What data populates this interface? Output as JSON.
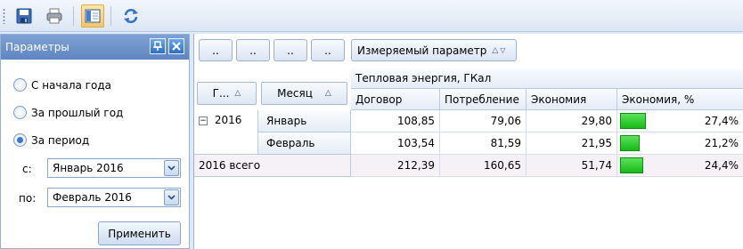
{
  "toolbar": {
    "icons": [
      "save-icon",
      "print-icon",
      "panel-toggle-icon",
      "refresh-icon"
    ]
  },
  "params": {
    "title": "Параметры",
    "radio_options": [
      {
        "label": "С начала года",
        "selected": false
      },
      {
        "label": "За прошлый год",
        "selected": false
      },
      {
        "label": "За период",
        "selected": true
      }
    ],
    "from_label": "с:",
    "from_value": "Январь 2016",
    "to_label": "по:",
    "to_value": "Февраль 2016",
    "apply_label": "Применить"
  },
  "grid": {
    "filter_buttons": [
      "..",
      "..",
      "..",
      ".."
    ],
    "measure_button": "Измеряемый параметр",
    "group_header": "Тепловая энергия, ГКал",
    "row_headers": [
      "Г...",
      "Месяц"
    ],
    "columns": [
      "Договор",
      "Потребление",
      "Экономия",
      "Экономия, %"
    ],
    "year": "2016",
    "rows": [
      {
        "month": "Январь",
        "values": [
          "108,85",
          "79,06",
          "29,80"
        ],
        "pct": "27,4%",
        "pct_value": 27.4
      },
      {
        "month": "Февраль",
        "values": [
          "103,54",
          "81,59",
          "21,95"
        ],
        "pct": "21,2%",
        "pct_value": 21.2
      }
    ],
    "total": {
      "label": "2016 всего",
      "values": [
        "212,39",
        "160,65",
        "51,74"
      ],
      "pct": "24,4%",
      "pct_value": 24.4
    }
  },
  "colors": {
    "accent": "#5f86c2",
    "bar": "#2ecc2e"
  }
}
